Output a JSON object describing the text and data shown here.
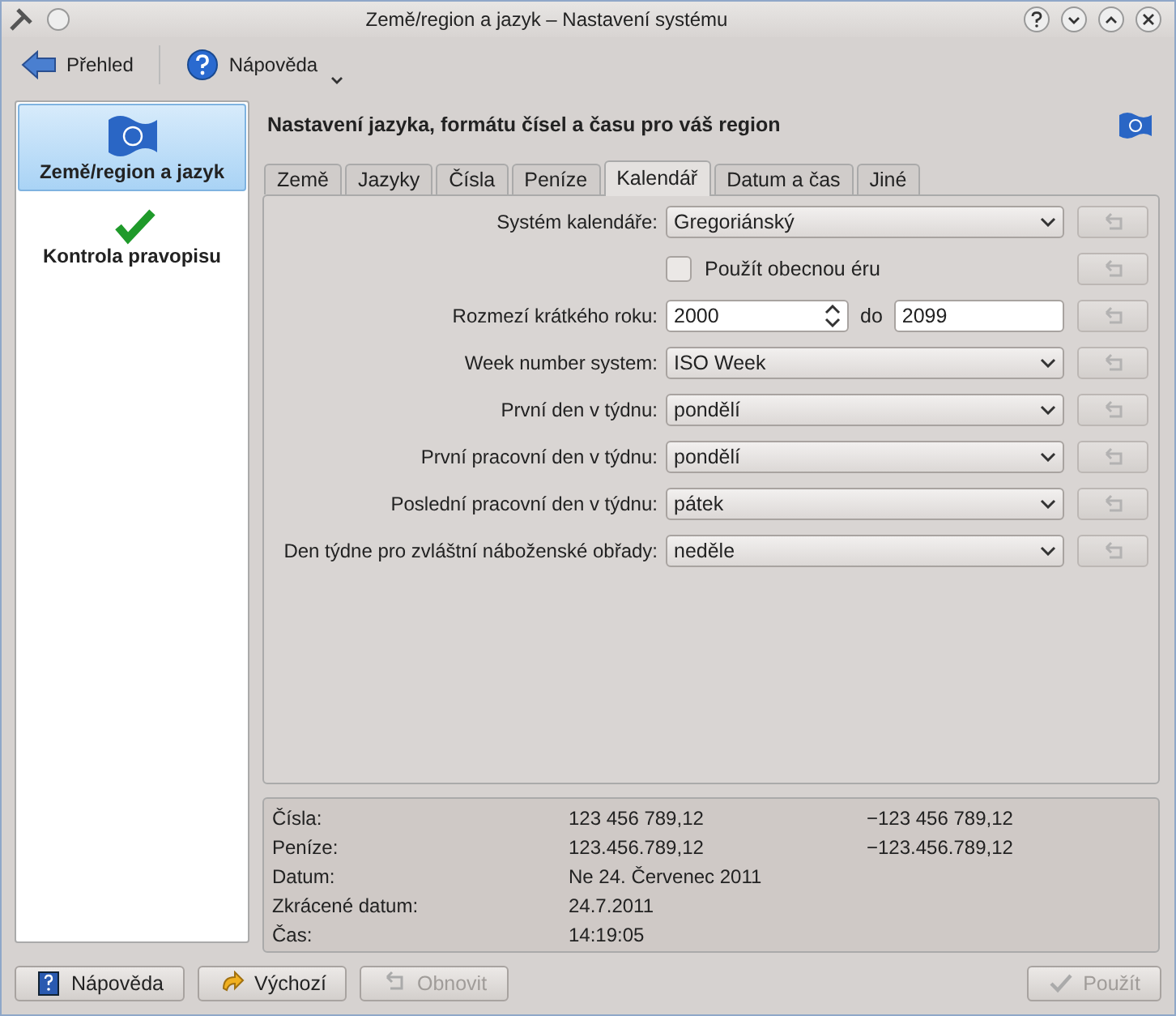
{
  "window": {
    "title": "Země/region a jazyk – Nastavení systému"
  },
  "toolbar": [
    {
      "label": "Přehled",
      "kind": "back"
    },
    {
      "label": "Nápověda",
      "kind": "help"
    }
  ],
  "sidebar": {
    "items": [
      {
        "label": "Země/region a jazyk",
        "kind": "flag",
        "selected": true
      },
      {
        "label": "Kontrola pravopisu",
        "kind": "spell",
        "selected": false
      }
    ]
  },
  "heading": "Nastavení jazyka, formátu čísel a času pro váš region",
  "tabs": [
    {
      "label": "Země",
      "selected": false
    },
    {
      "label": "Jazyky",
      "selected": false
    },
    {
      "label": "Čísla",
      "selected": false
    },
    {
      "label": "Peníze",
      "selected": false
    },
    {
      "label": "Kalendář",
      "selected": true
    },
    {
      "label": "Datum a čas",
      "selected": false
    },
    {
      "label": "Jiné",
      "selected": false
    }
  ],
  "settings": [
    {
      "kind": "combo",
      "label": "Systém kalendáře:",
      "value": "Gregoriánský"
    },
    {
      "kind": "checkbox",
      "label": "Použít obecnou éru",
      "checked": false
    },
    {
      "kind": "range",
      "label": "Rozmezí krátkého roku:",
      "from": "2000",
      "separator": "do",
      "to": "2099"
    },
    {
      "kind": "combo",
      "label": "Week number system:",
      "value": "ISO Week"
    },
    {
      "kind": "combo",
      "label": "První den v týdnu:",
      "value": "pondělí"
    },
    {
      "kind": "combo",
      "label": "První pracovní den v týdnu:",
      "value": "pondělí"
    },
    {
      "kind": "combo",
      "label": "Poslední pracovní den v týdnu:",
      "value": "pátek"
    },
    {
      "kind": "combo",
      "label": "Den týdne pro zvláštní náboženské obřady:",
      "value": "neděle"
    }
  ],
  "preview": [
    {
      "label": "Čísla:",
      "value": "123 456 789,12",
      "negative": "−123 456 789,12"
    },
    {
      "label": "Peníze:",
      "value": "123.456.789,12",
      "negative": "−123.456.789,12"
    },
    {
      "label": "Datum:",
      "value": "Ne 24. Červenec 2011"
    },
    {
      "label": "Zkrácené datum:",
      "value": "24.7.2011"
    },
    {
      "label": "Čas:",
      "value": "14:19:05"
    }
  ],
  "buttons": [
    {
      "label": "Nápověda",
      "kind": "help",
      "disabled": false
    },
    {
      "label": "Výchozí",
      "kind": "defaults",
      "disabled": false
    },
    {
      "label": "Obnovit",
      "kind": "reset",
      "disabled": true
    },
    {
      "label": "Použít",
      "kind": "apply",
      "disabled": true
    }
  ]
}
